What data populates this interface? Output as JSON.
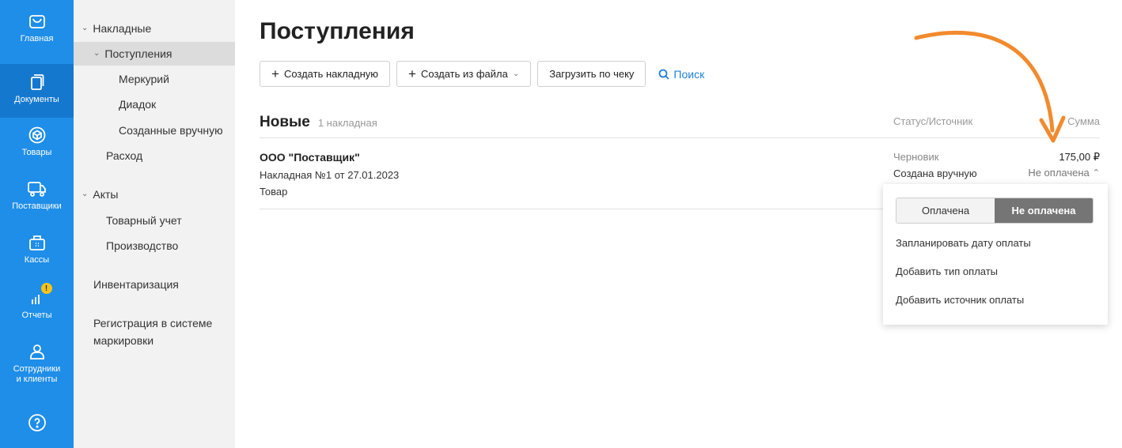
{
  "rail": {
    "items": [
      {
        "label": "Главная",
        "icon": "bag-icon"
      },
      {
        "label": "Документы",
        "icon": "documents-icon"
      },
      {
        "label": "Товары",
        "icon": "box-icon"
      },
      {
        "label": "Поставщики",
        "icon": "truck-icon"
      },
      {
        "label": "Кассы",
        "icon": "cash-register-icon"
      },
      {
        "label": "Отчеты",
        "icon": "bar-chart-icon",
        "badge": "!"
      },
      {
        "label": "Сотрудники\nи клиенты",
        "icon": "person-icon"
      }
    ],
    "help_icon": "question-icon",
    "bg_color": "#1f8ee8"
  },
  "subnav": {
    "invoices": "Накладные",
    "receipts": "Поступления",
    "mercury": "Меркурий",
    "diadoc": "Диадок",
    "manual": "Созданные вручную",
    "expense": "Расход",
    "acts": "Акты",
    "goods_accounting": "Товарный учет",
    "production": "Производство",
    "inventory": "Инвентаризация",
    "marking": "Регистрация в системе маркировки"
  },
  "main": {
    "title": "Поступления",
    "toolbar": {
      "create_invoice": "Создать накладную",
      "create_from_file": "Создать из файла",
      "load_by_receipt": "Загрузить по чеку",
      "search": "Поиск"
    },
    "section": {
      "title": "Новые",
      "count": "1 накладная",
      "col_status": "Статус/Источник",
      "col_sum": "Сумма"
    },
    "row": {
      "supplier": "ООО \"Поставщик\"",
      "doc": "Накладная №1 от 27.01.2023",
      "goods": "Товар",
      "status": "Черновик",
      "source": "Создана вручную",
      "amount": "175,00 ₽",
      "pay_state": "Не оплачена"
    }
  },
  "popup": {
    "paid": "Оплачена",
    "unpaid": "Не оплачена",
    "selected": "Не оплачена",
    "plan_date": "Запланировать дату оплаты",
    "add_type": "Добавить тип оплаты",
    "add_source": "Добавить источник оплаты"
  },
  "accent_color": "#f28a2e"
}
